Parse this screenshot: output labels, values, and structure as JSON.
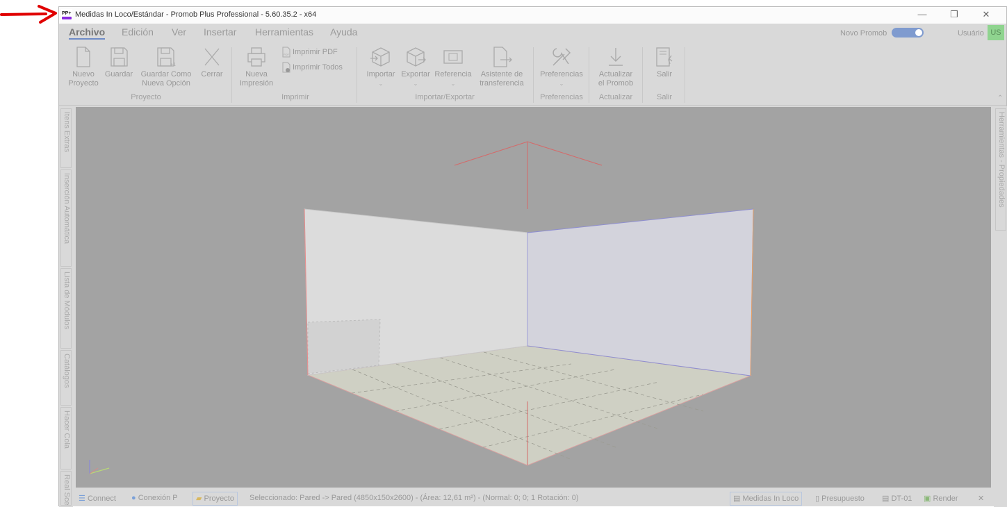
{
  "window": {
    "title": "Medidas In Loco/Estándar - Promob Plus Professional - 5.60.35.2 - x64",
    "logo_text": "PP+",
    "controls": [
      "—",
      "❐",
      "✕"
    ]
  },
  "menu": {
    "items": [
      "Archivo",
      "Edición",
      "Ver",
      "Insertar",
      "Herramientas",
      "Ayuda"
    ],
    "novo_promob_label": "Novo Promob",
    "usuario_label": "Usuário",
    "user_initials": "US"
  },
  "ribbon": {
    "proyecto": {
      "nuevo_l1": "Nuevo",
      "nuevo_l2": "Proyecto",
      "guardar": "Guardar",
      "guardar_como_l1": "Guardar Como",
      "guardar_como_l2": "Nueva Opción",
      "cerrar": "Cerrar",
      "label": "Proyecto"
    },
    "imprimir": {
      "nueva_l1": "Nueva",
      "nueva_l2": "Impresión",
      "pdf": "Imprimir PDF",
      "todos": "Imprimir Todos",
      "label": "Imprimir"
    },
    "importar_exportar": {
      "importar": "Importar",
      "exportar": "Exportar",
      "referencia": "Referencia",
      "asistente_l1": "Asistente de",
      "asistente_l2": "transferencia",
      "label": "Importar/Exportar"
    },
    "preferencias": {
      "btn": "Preferencias",
      "label": "Preferencias"
    },
    "actualizar": {
      "btn_l1": "Actualizar",
      "btn_l2": "el Promob",
      "label": "Actualizar"
    },
    "salir": {
      "btn": "Salir",
      "label": "Salir"
    },
    "caret": "⌄",
    "collapse": "⌃"
  },
  "left_tabs": [
    "Itens Extras",
    "Inserción Automática",
    "Lista de Módulos",
    "Catálogos",
    "Hacer Cola",
    "Real Scen"
  ],
  "right_tabs": [
    "Herramientas - Propiedades"
  ],
  "status": {
    "connect": "Connect",
    "conexion": "Conexión P",
    "proyecto": "Proyecto",
    "seleccionado": "Seleccionado: Pared -> Pared (4850x150x2600) - (Área: 12,61 m²) - (Normal: 0; 0; 1 Rotación: 0)",
    "medidas": "Medidas In Loco",
    "presupuesto": "Presupuesto",
    "dt": "DT-01",
    "render": "Render",
    "close": "✕"
  }
}
